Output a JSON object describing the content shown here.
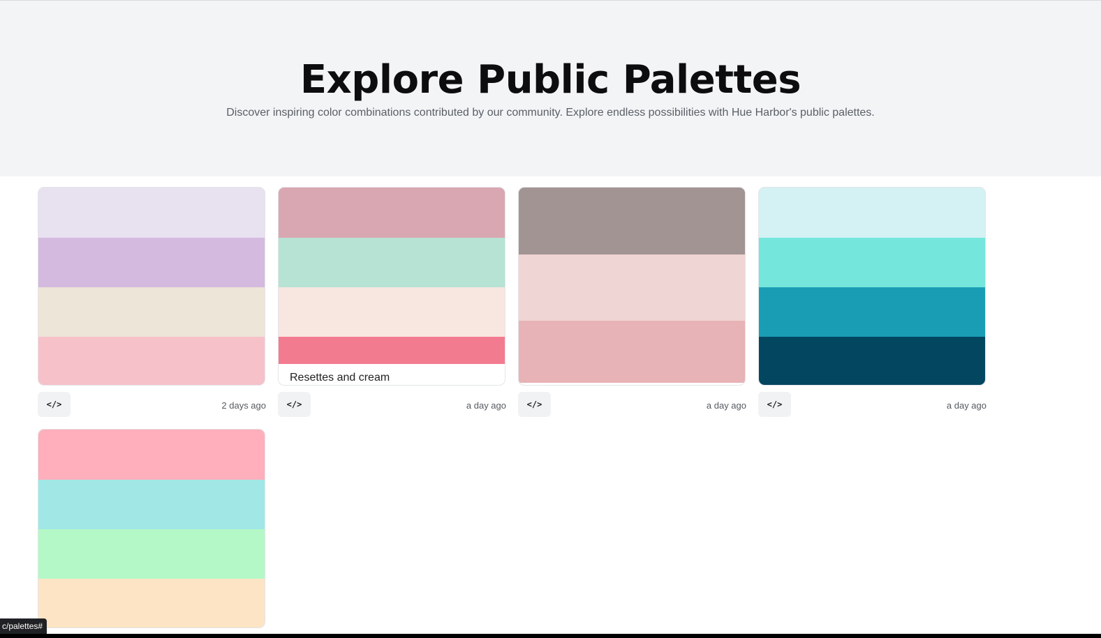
{
  "hero": {
    "title": "Explore Public Palettes",
    "subtitle": "Discover inspiring color combinations contributed by our community. Explore endless possibilities with Hue Harbor's public palettes."
  },
  "palettes": [
    {
      "colors": [
        "#e8e1ef",
        "#d4bade",
        "#ede5d8",
        "#f7c1ca"
      ],
      "name": "",
      "code_label": "</>",
      "age": "2 days ago"
    },
    {
      "colors": [
        "#d9a7b1",
        "#b7e3d4",
        "#f8e6e1",
        "#f37b8f"
      ],
      "name": "Resettes and cream",
      "code_label": "</>",
      "age": "a day ago"
    },
    {
      "colors": [
        "#a39494",
        "#efd5d3",
        "#e8b3b6"
      ],
      "name": "",
      "code_label": "</>",
      "age": "a day ago"
    },
    {
      "colors": [
        "#d4f1f3",
        "#75e6dc",
        "#199db4",
        "#034660"
      ],
      "name": "",
      "code_label": "</>",
      "age": "a day ago"
    },
    {
      "colors": [
        "#ffafbc",
        "#a0e7e5",
        "#b5f8c8",
        "#fde4c5"
      ],
      "name": "",
      "code_label": "",
      "age": ""
    }
  ],
  "status_bar": {
    "url_tip": "c/palettes#"
  }
}
